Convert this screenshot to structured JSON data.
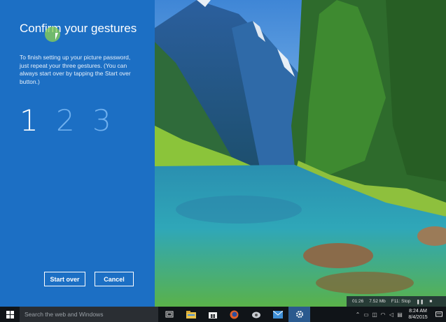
{
  "panel": {
    "title": "Confirm your gestures",
    "description": "To finish setting up your picture password, just repeat your three gestures. (You can always start over by tapping the Start over button.)",
    "steps": [
      "1",
      "2",
      "3"
    ],
    "start_over_label": "Start over",
    "cancel_label": "Cancel"
  },
  "recorder": {
    "time": "01:26",
    "size": "7.52 Mb",
    "stop_label": "F11: Stop"
  },
  "taskbar": {
    "search_placeholder": "Search the web and Windows",
    "icons": [
      "task-view-icon",
      "file-explorer-icon",
      "store-icon",
      "firefox-icon",
      "media-icon",
      "mail-icon",
      "settings-icon"
    ],
    "clock_time": "8:24 AM",
    "clock_date": "8/4/2015"
  },
  "colors": {
    "panel_bg": "#1c6fc4",
    "step_active": "#ffffff",
    "step_inactive": "#6fb0ef",
    "taskbar_bg": "#101418"
  }
}
